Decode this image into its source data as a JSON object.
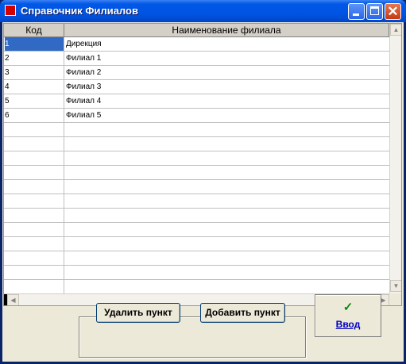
{
  "window": {
    "title": "Справочник Филиалов",
    "title_color": "#0054e3",
    "close_glyph": "✕"
  },
  "grid": {
    "columns": [
      "Код",
      "Наименование филиала"
    ],
    "rows": [
      {
        "code": "1",
        "name": "Дирекция"
      },
      {
        "code": "2",
        "name": "Филиал 1"
      },
      {
        "code": "3",
        "name": "Филиал 2"
      },
      {
        "code": "4",
        "name": "Филиал 3"
      },
      {
        "code": "5",
        "name": "Филиал 4"
      },
      {
        "code": "6",
        "name": "Филиал 5"
      }
    ],
    "selected_color": "#316ac5"
  },
  "buttons": {
    "delete_label": "Удалить пункт",
    "add_label": "Добавить пункт",
    "ok_label": "Ввод",
    "ok_icon": "checkmark-icon"
  }
}
